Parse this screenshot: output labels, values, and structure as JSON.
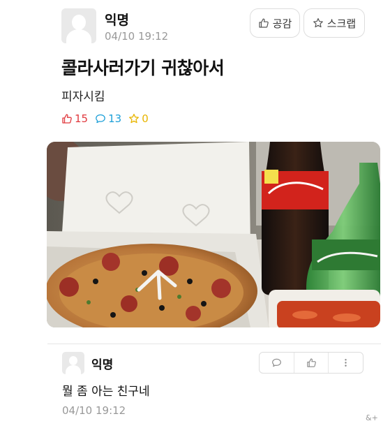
{
  "post": {
    "author": "익명",
    "date": "04/10 19:12",
    "like_button_label": "공감",
    "scrap_button_label": "스크랩",
    "title": "콜라사러가기 귀찮아서",
    "body": "피자시킴",
    "stats": {
      "likes": "15",
      "comments": "13",
      "scraps": "0"
    }
  },
  "comment": {
    "author": "익명",
    "text": "뭘 좀 아는 친구네",
    "date": "04/10 19:12"
  },
  "watermark": "&+",
  "colors": {
    "like": "#e0393e",
    "comment": "#1ea0d8",
    "scrap": "#e8b500",
    "meta": "#999999"
  },
  "icons": [
    "thumb-up-icon",
    "star-icon",
    "speech-bubble-icon",
    "more-vertical-icon"
  ]
}
